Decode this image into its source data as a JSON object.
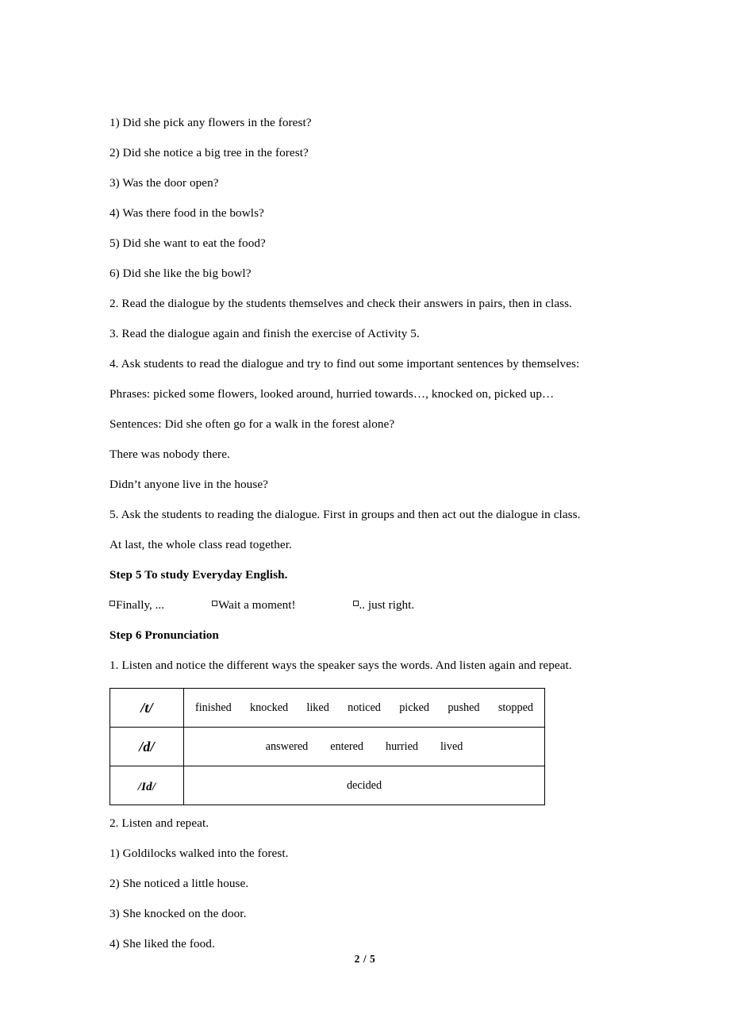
{
  "document": {
    "page_label": "2 / 5"
  },
  "body": {
    "questions": [
      "1) Did she pick any flowers in the forest?",
      "2) Did she notice a big tree in the forest?",
      "3) Was the door open?",
      "4) Was there food in the bowls?",
      "5) Did she want to eat the food?",
      "6) Did she like the big bowl?"
    ],
    "instructions": [
      "2. Read the dialogue by the students themselves and check their answers in pairs, then in class.",
      "3. Read the dialogue again and finish the exercise of Activity 5.",
      "4. Ask students to read the dialogue and try to find out some important sentences by themselves:",
      "Phrases: picked some flowers, looked around, hurried towards…, knocked on, picked up…",
      "Sentences: Did she often go for a walk in the forest alone?",
      "There was nobody there.",
      "Didn’t anyone live in the house?",
      "5. Ask the students to reading the dialogue. First in groups and then act out the dialogue in class.",
      "At last, the whole class read together."
    ]
  },
  "step5": {
    "heading": "Step 5 To study Everyday English.",
    "items": [
      "Finally, ...",
      "Wait a moment!",
      ".. just right."
    ]
  },
  "step6": {
    "heading": "Step 6 Pronunciation",
    "listen_note": "1. Listen and notice the different ways the speaker says the words. And listen again and repeat.",
    "table": {
      "rows": [
        {
          "symbol": "/t/",
          "symbol_prefix": "",
          "align": "justify",
          "words": [
            "finished",
            "knocked",
            "liked",
            "noticed",
            "picked",
            "pushed",
            "stopped"
          ]
        },
        {
          "symbol": "/d/",
          "symbol_prefix": "",
          "align": "center",
          "words": [
            "answered",
            "entered",
            "hurried",
            "lived"
          ]
        },
        {
          "symbol": "/Id/",
          "symbol_prefix": "",
          "align": "solo",
          "words": [
            "decided"
          ]
        }
      ]
    },
    "repeat_note": "2. Listen and repeat.",
    "sentences": [
      "1) Goldilocks walked into the forest.",
      "2) She noticed a little house.",
      "3) She knocked on the door.",
      "4) She liked the food."
    ]
  }
}
